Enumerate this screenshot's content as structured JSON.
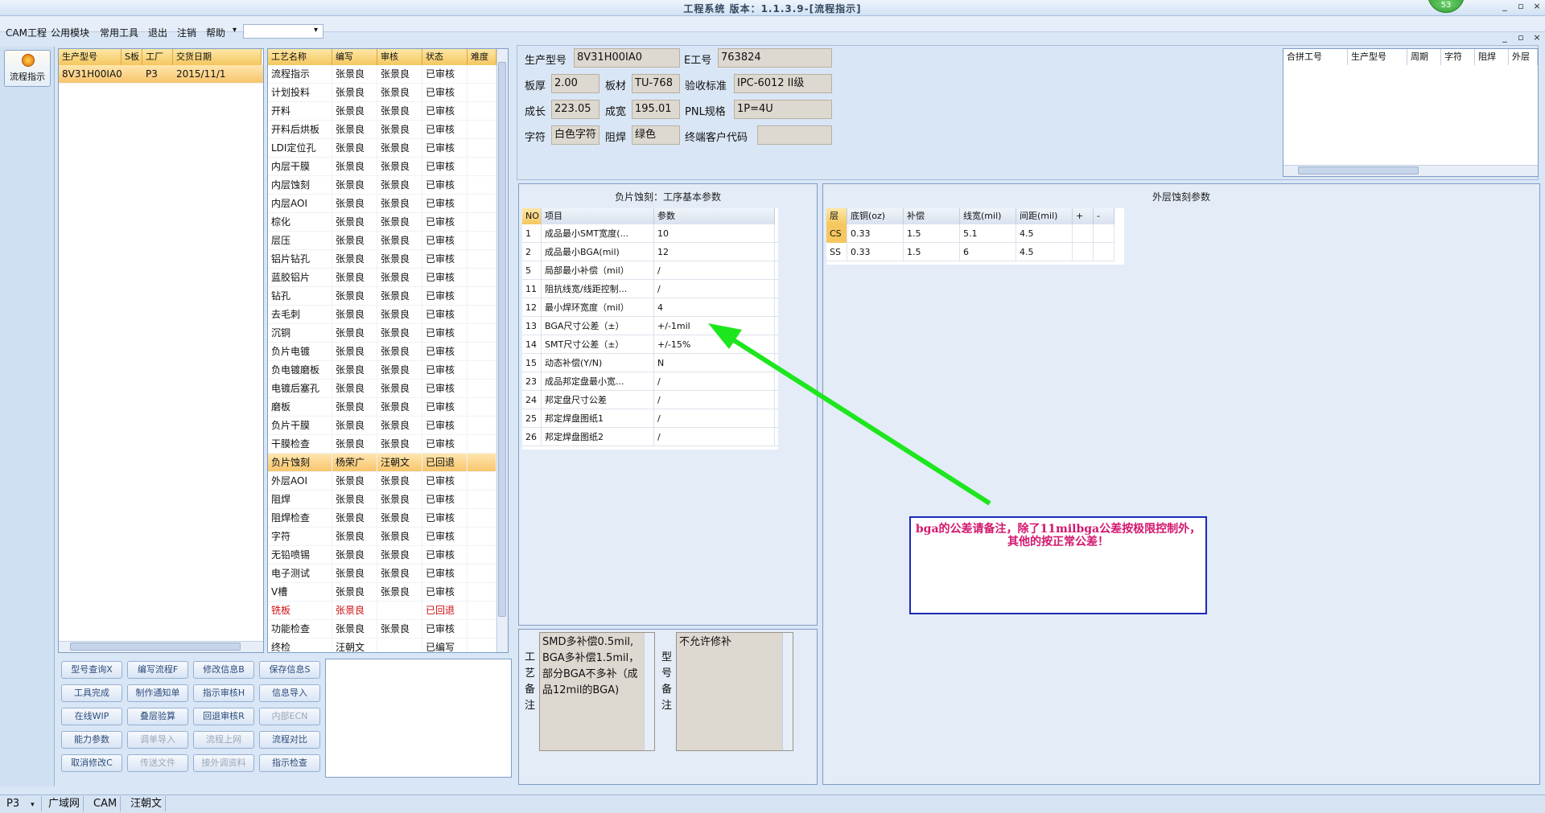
{
  "window": {
    "title": "工程系统 版本：1.1.3.9-[流程指示]",
    "badge": "53",
    "min": "_",
    "max": "▫",
    "close": "×",
    "child_min": "_",
    "child_max": "▫",
    "child_close": "×"
  },
  "menu": {
    "items": [
      "CAM工程",
      "公用模块",
      "常用工具",
      "退出",
      "注销",
      "帮助"
    ],
    "help_arrow": "▾",
    "combo_arrow": "▾"
  },
  "sidebar": {
    "flow_button": "流程指示"
  },
  "orders": {
    "columns": [
      "生产型号",
      "S板",
      "工厂",
      "交货日期"
    ],
    "rows": [
      [
        "8V31H00IA0",
        "",
        "P3",
        "2015/11/1"
      ]
    ]
  },
  "process": {
    "columns": [
      "工艺名称",
      "编写",
      "审核",
      "状态",
      "难度"
    ],
    "rows": [
      [
        "流程指示",
        "张景良",
        "张景良",
        "已审核",
        ""
      ],
      [
        "计划投料",
        "张景良",
        "张景良",
        "已审核",
        ""
      ],
      [
        "开料",
        "张景良",
        "张景良",
        "已审核",
        ""
      ],
      [
        "开料后烘板",
        "张景良",
        "张景良",
        "已审核",
        ""
      ],
      [
        "LDI定位孔",
        "张景良",
        "张景良",
        "已审核",
        ""
      ],
      [
        "内层干膜",
        "张景良",
        "张景良",
        "已审核",
        ""
      ],
      [
        "内层蚀刻",
        "张景良",
        "张景良",
        "已审核",
        ""
      ],
      [
        "内层AOI",
        "张景良",
        "张景良",
        "已审核",
        ""
      ],
      [
        "棕化",
        "张景良",
        "张景良",
        "已审核",
        ""
      ],
      [
        "层压",
        "张景良",
        "张景良",
        "已审核",
        ""
      ],
      [
        "铝片钻孔",
        "张景良",
        "张景良",
        "已审核",
        ""
      ],
      [
        "蓝胶铝片",
        "张景良",
        "张景良",
        "已审核",
        ""
      ],
      [
        "钻孔",
        "张景良",
        "张景良",
        "已审核",
        ""
      ],
      [
        "去毛刺",
        "张景良",
        "张景良",
        "已审核",
        ""
      ],
      [
        "沉铜",
        "张景良",
        "张景良",
        "已审核",
        ""
      ],
      [
        "负片电镀",
        "张景良",
        "张景良",
        "已审核",
        ""
      ],
      [
        "负电镀磨板",
        "张景良",
        "张景良",
        "已审核",
        ""
      ],
      [
        "电镀后塞孔",
        "张景良",
        "张景良",
        "已审核",
        ""
      ],
      [
        "磨板",
        "张景良",
        "张景良",
        "已审核",
        ""
      ],
      [
        "负片干膜",
        "张景良",
        "张景良",
        "已审核",
        ""
      ],
      [
        "干膜检查",
        "张景良",
        "张景良",
        "已审核",
        ""
      ],
      [
        "负片蚀刻",
        "杨荣广",
        "汪朝文",
        "已回退",
        ""
      ],
      [
        "外层AOI",
        "张景良",
        "张景良",
        "已审核",
        ""
      ],
      [
        "阻焊",
        "张景良",
        "张景良",
        "已审核",
        ""
      ],
      [
        "阻焊检查",
        "张景良",
        "张景良",
        "已审核",
        ""
      ],
      [
        "字符",
        "张景良",
        "张景良",
        "已审核",
        ""
      ],
      [
        "无铅喷锡",
        "张景良",
        "张景良",
        "已审核",
        ""
      ],
      [
        "电子测试",
        "张景良",
        "张景良",
        "已审核",
        ""
      ],
      [
        "V槽",
        "张景良",
        "张景良",
        "已审核",
        ""
      ],
      [
        "铣板",
        "张景良",
        "",
        "已回退",
        ""
      ],
      [
        "功能检查",
        "张景良",
        "张景良",
        "已审核",
        ""
      ],
      [
        "终检",
        "汪朝文",
        "",
        "已编写",
        ""
      ]
    ],
    "selected_index": 21,
    "red_index": 29
  },
  "buttons": [
    [
      "型号查询X",
      "编写流程F",
      "修改信息B",
      "保存信息S"
    ],
    [
      "工具完成",
      "制作通知单",
      "指示审核H",
      "信息导入"
    ],
    [
      "在线WIP",
      "叠层验算",
      "回退审核R",
      "内部ECN"
    ],
    [
      "能力参数",
      "调单导入",
      "流程上网",
      "流程对比"
    ],
    [
      "取消修改C",
      "传送文件",
      "接外调资料",
      "指示检查"
    ]
  ],
  "disabled_buttons": [
    "内部ECN",
    "调单导入",
    "流程上网",
    "传送文件",
    "接外调资料"
  ],
  "info": {
    "model_label": "生产型号",
    "model": "8V31H00IA0",
    "eno_label": "E工号",
    "eno": "763824",
    "thick_label": "板厚",
    "thick": "2.00",
    "material_label": "板材",
    "material": "TU-768",
    "std_label": "验收标准",
    "std": "IPC-6012 II级",
    "len_label": "成长",
    "len": "223.05",
    "wid_label": "成宽",
    "wid": "195.01",
    "pnl_label": "PNL规格",
    "pnl": "1P=4U",
    "char_label": "字符",
    "char": "白色字符",
    "mask_label": "阻焊",
    "mask": "绿色",
    "cust_label": "终端客户代码",
    "cust": ""
  },
  "merge": {
    "columns": [
      "合拼工号",
      "生产型号",
      "周期",
      "字符",
      "阻焊",
      "外层"
    ]
  },
  "params": {
    "title": "负片蚀刻：工序基本参数",
    "columns": [
      "NO",
      "项目",
      "参数"
    ],
    "rows": [
      [
        "1",
        "成品最小SMT宽度(...",
        "10"
      ],
      [
        "2",
        "成品最小BGA(mil)",
        "12"
      ],
      [
        "5",
        "局部最小补偿（mil）",
        "/"
      ],
      [
        "11",
        "阻抗线宽/线距控制...",
        "/"
      ],
      [
        "12",
        "最小焊环宽度（mil）",
        "4"
      ],
      [
        "13",
        "BGA尺寸公差（±）",
        "+/-1mil"
      ],
      [
        "14",
        "SMT尺寸公差（±）",
        "+/-15%"
      ],
      [
        "15",
        "动态补偿(Y/N)",
        "N"
      ],
      [
        "23",
        "成品邦定盘最小宽...",
        "/"
      ],
      [
        "24",
        "邦定盘尺寸公差",
        "/"
      ],
      [
        "25",
        "邦定焊盘图纸1",
        "/"
      ],
      [
        "26",
        "邦定焊盘图纸2",
        "/"
      ]
    ]
  },
  "outer": {
    "title": "外层蚀刻参数",
    "columns": [
      "层",
      "底铜(oz)",
      "补偿",
      "线宽(mil)",
      "间距(mil)",
      "+",
      "-"
    ],
    "rows": [
      [
        "CS",
        "0.33",
        "1.5",
        "5.1",
        "4.5",
        "",
        ""
      ],
      [
        "SS",
        "0.33",
        "1.5",
        "6",
        "4.5",
        "",
        ""
      ]
    ]
  },
  "remarks": {
    "process_label": "工艺备注",
    "process_text": "SMD多补偿0.5mil,BGA多补偿1.5mil，部分BGA不多补（成品12mil的BGA)",
    "model_label": "型号备注",
    "model_text": "不允许修补"
  },
  "annotation": "bga的公差请备注，除了11milbga公差按极限控制外，其他的按正常公差！",
  "status": {
    "factory": "P3",
    "net": "广域网",
    "dept": "CAM",
    "user": "汪朝文",
    "arrow": "▾"
  },
  "colors": {
    "header_orange": "#f5c75e",
    "annotation_text": "#d4166d",
    "annotation_border": "#1a2ab8",
    "arrow": "#1ee61e",
    "returned_red": "#d01010"
  }
}
